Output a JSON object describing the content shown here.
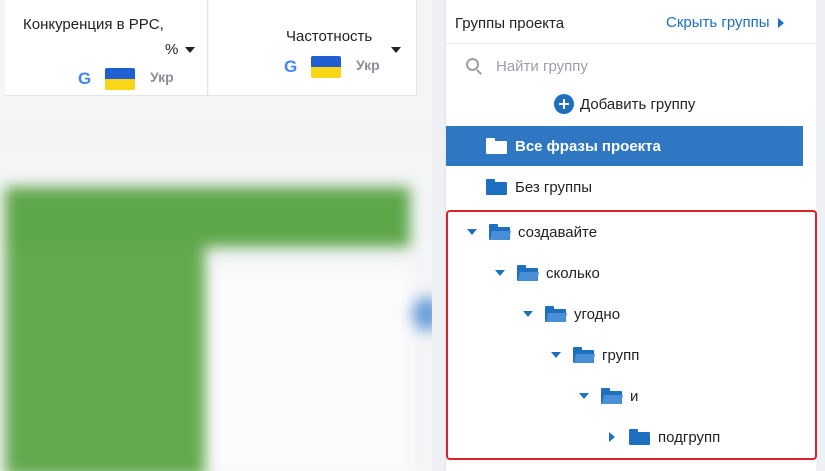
{
  "table": {
    "columns": [
      {
        "title_line1": "Конкуренция в PPC,",
        "title_line2": "%",
        "engine": "G",
        "region": "Укр"
      },
      {
        "title_line1": "Частотность",
        "engine": "G",
        "region": "Укр"
      }
    ]
  },
  "groups_panel": {
    "title": "Группы проекта",
    "hide_label": "Скрыть группы",
    "search_placeholder": "Найти группу",
    "add_group_label": "Добавить группу",
    "all_phrases_label": "Все фразы проекта",
    "no_group_label": "Без группы",
    "tree": [
      {
        "label": "создавайте",
        "level": 0,
        "expanded": true
      },
      {
        "label": "сколько",
        "level": 1,
        "expanded": true
      },
      {
        "label": "угодно",
        "level": 2,
        "expanded": true
      },
      {
        "label": "групп",
        "level": 3,
        "expanded": true
      },
      {
        "label": "и",
        "level": 4,
        "expanded": true
      },
      {
        "label": "подгрупп",
        "level": 5,
        "expanded": false
      }
    ]
  },
  "colors": {
    "accent": "#1e6fc0",
    "active_row": "#2f77c3",
    "highlight_border": "#d8232a"
  }
}
